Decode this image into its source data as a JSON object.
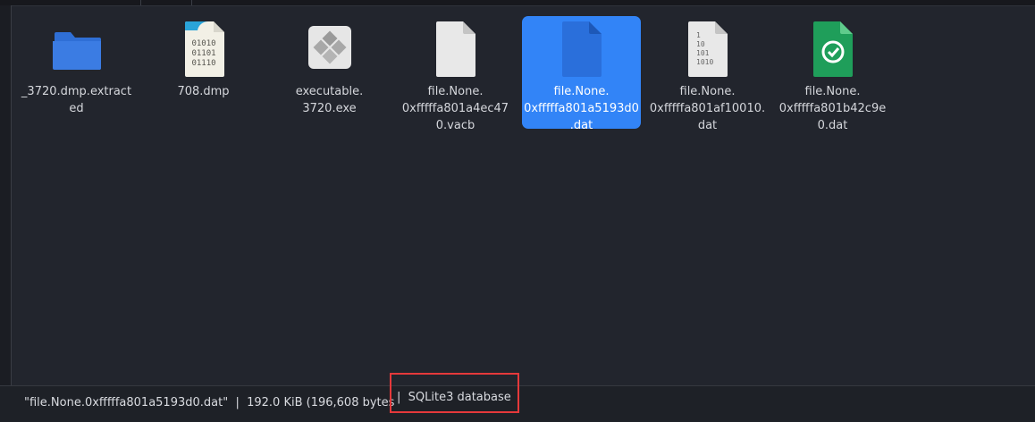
{
  "files": [
    {
      "label": "_3720.dmp.extract\ned",
      "icon": "folder-icon",
      "selected": false
    },
    {
      "label": "708.dmp",
      "icon": "binary-file-icon",
      "selected": false
    },
    {
      "label": "executable.\n3720.exe",
      "icon": "executable-file-icon",
      "selected": false
    },
    {
      "label": "file.None.\n0xfffffa801a4ec47\n0.vacb",
      "icon": "generic-file-icon",
      "selected": false
    },
    {
      "label": "file.None.\n0xfffffa801a5193d0\n.dat",
      "icon": "selected-file-icon",
      "selected": true
    },
    {
      "label": "file.None.\n0xfffffa801af10010.\ndat",
      "icon": "binary-data-file-icon",
      "selected": false
    },
    {
      "label": "file.None.\n0xfffffa801b42c9e\n0.dat",
      "icon": "torrent-file-icon",
      "selected": false
    }
  ],
  "status": {
    "info": "\"file.None.0xfffffa801a5193d0.dat\"  |  192.0 KiB (196,608 bytes",
    "type": "|  SQLite3 database"
  },
  "colors": {
    "background": "#22252d",
    "selection": "#3284f7",
    "highlight_box": "#e5393b",
    "folder": "#3b7ce3"
  }
}
